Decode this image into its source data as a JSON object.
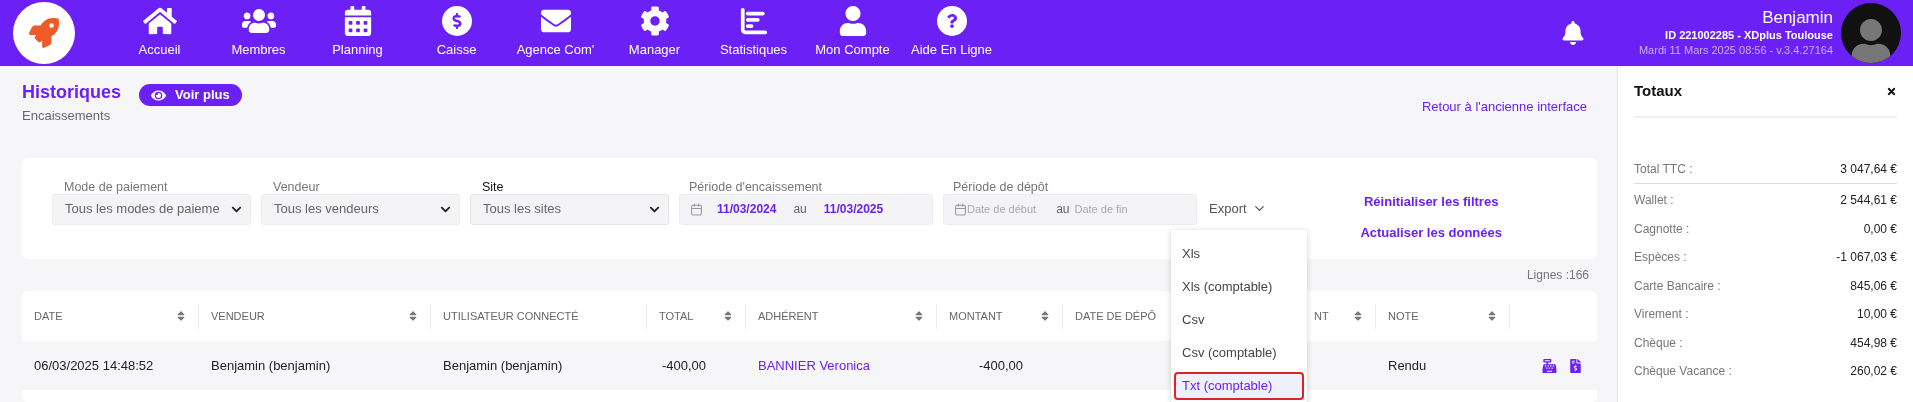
{
  "nav": {
    "items": [
      {
        "label": "Accueil"
      },
      {
        "label": "Membres"
      },
      {
        "label": "Planning"
      },
      {
        "label": "Caisse"
      },
      {
        "label": "Agence Com'"
      },
      {
        "label": "Manager"
      },
      {
        "label": "Statistiques"
      },
      {
        "label": "Mon Compte"
      },
      {
        "label": "Aide En Ligne"
      }
    ]
  },
  "user": {
    "name": "Benjamin",
    "id_line": "ID 221002285 - XDplus Toulouse",
    "date_line": "Mardi 11 Mars 2025 08:56 - v.3.4.27164"
  },
  "header": {
    "title": "Historiques",
    "subtitle": "Encaissements",
    "voir_plus": "Voir plus",
    "back_link": "Retour à l'ancienne interface"
  },
  "filters": [
    {
      "label": "Mode de paiement",
      "value": "Tous les modes de paieme",
      "focused": false
    },
    {
      "label": "Vendeur",
      "value": "Tous les vendeurs",
      "focused": false
    },
    {
      "label": "Site",
      "value": "Tous les sites",
      "focused": true
    }
  ],
  "periods": [
    {
      "label": "Période d'encaissement",
      "from": "11/03/2024",
      "separator": "au",
      "to": "11/03/2025"
    },
    {
      "label": "Période de dépôt",
      "from_placeholder": "Date de début",
      "separator": "au",
      "to_placeholder": "Date de fin"
    }
  ],
  "export": {
    "label": "Export",
    "menu": [
      {
        "label": "Xls",
        "selected": false
      },
      {
        "label": "Xls (comptable)",
        "selected": false
      },
      {
        "label": "Csv",
        "selected": false
      },
      {
        "label": "Csv (comptable)",
        "selected": false
      },
      {
        "label": "Txt (comptable)",
        "selected": true
      }
    ]
  },
  "filter_actions": [
    "Réinitialiser les filtres",
    "Actualiser les données"
  ],
  "lines_count": "Lignes :166",
  "table": {
    "columns": [
      {
        "label": "DATE",
        "sortable": true
      },
      {
        "label": "VENDEUR",
        "sortable": true
      },
      {
        "label": "UTILISATEUR CONNECTÉ",
        "sortable": false
      },
      {
        "label": "TOTAL",
        "sortable": true
      },
      {
        "label": "ADHÉRENT",
        "sortable": true
      },
      {
        "label": "MONTANT",
        "sortable": true
      },
      {
        "label": "DATE DE DÉPÔ"
      },
      {
        "label": "NT",
        "sortable": true
      },
      {
        "label": "NOTE",
        "sortable": true
      }
    ],
    "rows": [
      {
        "cells": [
          {
            "text": "06/03/2025 14:48:52",
            "kind": "text"
          },
          {
            "text": "Benjamin (benjamin)",
            "kind": "text"
          },
          {
            "text": "Benjamin (benjamin)",
            "kind": "text"
          },
          {
            "text": "-400,00",
            "kind": "number"
          },
          {
            "text": "BANNIER Veronica",
            "kind": "link"
          },
          {
            "text": "-400,00",
            "kind": "number"
          },
          null,
          null,
          {
            "text": "Rendu",
            "kind": "text"
          }
        ]
      }
    ]
  },
  "totals": {
    "title": "Totaux",
    "rows": [
      {
        "label": "Total TTC :",
        "value": "3 047,64 €",
        "kind": "total"
      },
      {
        "label": "Wallet :",
        "value": "2 544,61 €",
        "kind": "line"
      },
      {
        "label": "Cagnotte :",
        "value": "0,00 €",
        "kind": "line"
      },
      {
        "label": "Espèces :",
        "value": "-1 067,03 €",
        "kind": "line"
      },
      {
        "label": "Carte Bancaire :",
        "value": "845,06 €",
        "kind": "line"
      },
      {
        "label": "Virement :",
        "value": "10,00 €",
        "kind": "line"
      },
      {
        "label": "Chèque :",
        "value": "454,98 €",
        "kind": "line"
      },
      {
        "label": "Chèque Vacance :",
        "value": "260,02 €",
        "kind": "line"
      }
    ]
  }
}
